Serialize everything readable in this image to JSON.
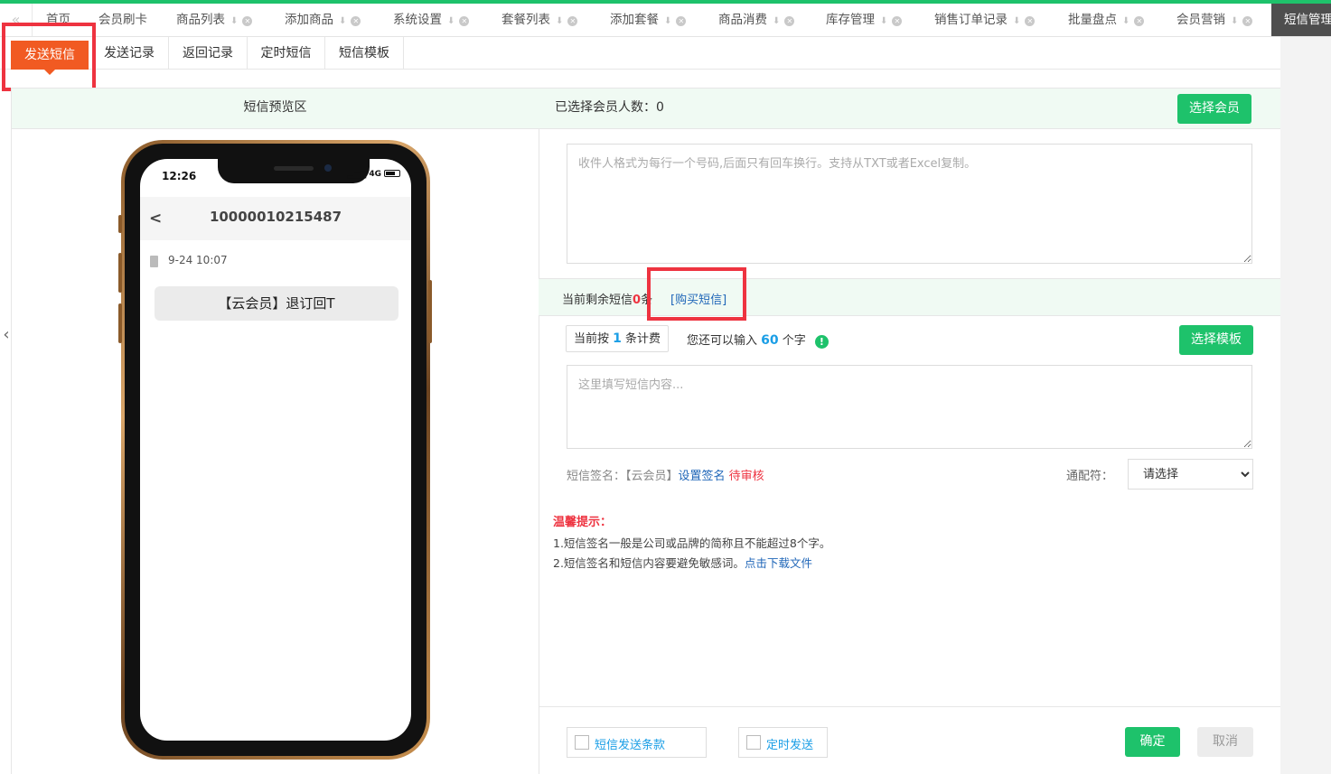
{
  "top_tabs": [
    {
      "label": "首页"
    },
    {
      "label": "会员刷卡"
    },
    {
      "label": "商品列表"
    },
    {
      "label": "添加商品"
    },
    {
      "label": "系统设置"
    },
    {
      "label": "套餐列表"
    },
    {
      "label": "添加套餐"
    },
    {
      "label": "商品消费"
    },
    {
      "label": "库存管理"
    },
    {
      "label": "销售订单记录"
    },
    {
      "label": "批量盘点"
    },
    {
      "label": "会员营销"
    },
    {
      "label": "短信管理"
    }
  ],
  "sub_tabs": [
    {
      "label": "发送短信",
      "active": true
    },
    {
      "label": "发送记录"
    },
    {
      "label": "返回记录"
    },
    {
      "label": "定时短信"
    },
    {
      "label": "短信模板"
    }
  ],
  "preview": {
    "header": "短信预览区",
    "status_time": "12:26",
    "network": "4G",
    "phone_number": "10000010215487",
    "back_symbol": "<",
    "message_time": "9-24  10:07",
    "message_text": "【云会员】退订回T"
  },
  "recipients": {
    "selected_label": "已选择会员人数：0",
    "select_button": "选择会员",
    "placeholder": "收件人格式为每行一个号码,后面只有回车换行。支持从TXT或者Excel复制。"
  },
  "sms_balance": {
    "prefix": "当前剩余短信",
    "count": "0",
    "suffix": "条",
    "buy_link": "[购买短信]"
  },
  "billing": {
    "prefix": "当前按",
    "count": "1",
    "suffix": "条计费",
    "remaining_prefix": "您还可以输入",
    "remaining_count": "60",
    "remaining_suffix": "个字",
    "template_button": "选择模板"
  },
  "content": {
    "placeholder": "这里填写短信内容..."
  },
  "signature": {
    "label": "短信签名：【云会员】",
    "set_link": "设置签名",
    "status": "待审核",
    "wildcard_label": "通配符：",
    "wildcard_value": "请选择"
  },
  "tips": {
    "title": "温馨提示：",
    "line1": "1.短信签名一般是公司或品牌的简称且不能超过8个字。",
    "line2": "2.短信签名和短信内容要避免敏感词。",
    "download_link": "点击下载文件"
  },
  "footer": {
    "terms_label": "短信发送条款",
    "scheduled_label": "定时发送",
    "confirm": "确定",
    "cancel": "取消"
  },
  "colors": {
    "accent_green": "#1ec26b",
    "active_tab_orange": "#f15a22",
    "highlight_red": "#ee3340",
    "link_blue": "#1f66b8"
  }
}
